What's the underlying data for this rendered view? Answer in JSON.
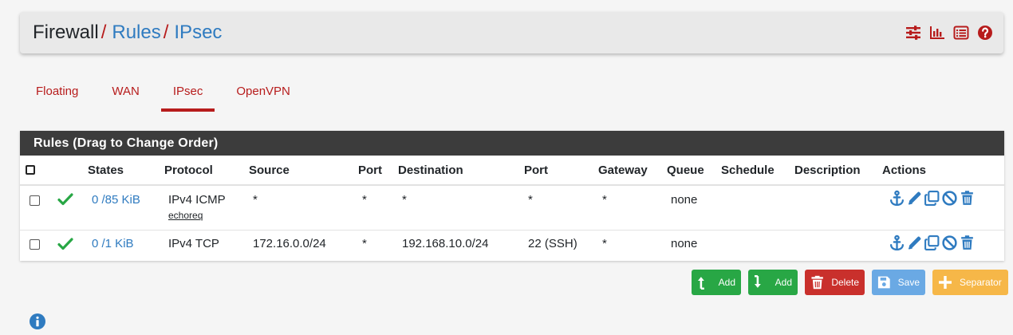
{
  "breadcrumb": {
    "root": "Firewall",
    "separator": "/",
    "items": [
      "Rules",
      "IPsec"
    ]
  },
  "toolbar": {
    "icons": [
      "sliders-icon",
      "bar-chart-icon",
      "list-icon",
      "help-icon"
    ]
  },
  "tabs": [
    {
      "label": "Floating",
      "active": false
    },
    {
      "label": "WAN",
      "active": false
    },
    {
      "label": "IPsec",
      "active": true
    },
    {
      "label": "OpenVPN",
      "active": false
    }
  ],
  "panel": {
    "title": "Rules (Drag to Change Order)"
  },
  "table": {
    "headers": {
      "states": "States",
      "protocol": "Protocol",
      "source": "Source",
      "port": "Port",
      "destination": "Destination",
      "dest_port": "Port",
      "gateway": "Gateway",
      "queue": "Queue",
      "schedule": "Schedule",
      "description": "Description",
      "actions": "Actions"
    },
    "rows": [
      {
        "states": "0 /85 KiB",
        "protocol": "IPv4 ICMP",
        "protocol_sub": "echoreq",
        "source": "*",
        "port": "*",
        "destination": "*",
        "dest_port": "*",
        "gateway": "*",
        "queue": "none",
        "schedule": "",
        "description": ""
      },
      {
        "states": "0 /1 KiB",
        "protocol": "IPv4 TCP",
        "protocol_sub": "",
        "source": "172.16.0.0/24",
        "port": "*",
        "destination": "192.168.10.0/24",
        "dest_port": "22 (SSH)",
        "gateway": "*",
        "queue": "none",
        "schedule": "",
        "description": ""
      }
    ]
  },
  "buttons": {
    "add_top": "Add",
    "add_bottom": "Add",
    "delete": "Delete",
    "save": "Save",
    "separator": "Separator"
  },
  "colors": {
    "accent_red": "#b71c1c",
    "link_blue": "#2f7bc0",
    "pass_green": "#28a745",
    "panel_header": "#3c3c3c"
  }
}
